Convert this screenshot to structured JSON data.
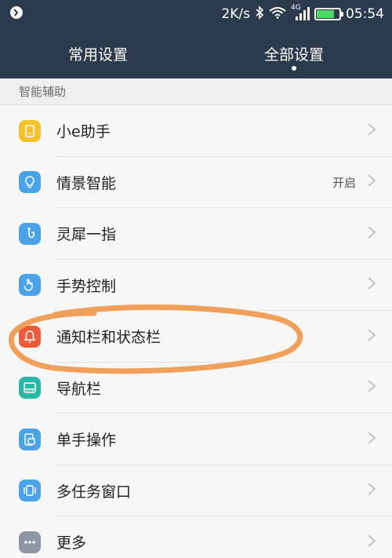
{
  "status_bar": {
    "speed": "2K/s",
    "network_label": "4G",
    "time": "05:54",
    "battery_level": 0.8
  },
  "tabs": [
    {
      "label": "常用设置",
      "active": false
    },
    {
      "label": "全部设置",
      "active": true
    }
  ],
  "section": {
    "title": "智能辅助"
  },
  "items": [
    {
      "label": "小e助手",
      "value": "",
      "icon": "phone-assistant-icon",
      "color": "#f6c12b"
    },
    {
      "label": "情景智能",
      "value": "开启",
      "icon": "lightbulb-icon",
      "color": "#4aa3e8"
    },
    {
      "label": "灵犀一指",
      "value": "",
      "icon": "finger-touch-icon",
      "color": "#4aa3e8"
    },
    {
      "label": "手势控制",
      "value": "",
      "icon": "hand-gesture-icon",
      "color": "#4aa3e8"
    },
    {
      "label": "通知栏和状态栏",
      "value": "",
      "icon": "bell-icon",
      "color": "#ee5a3c"
    },
    {
      "label": "导航栏",
      "value": "",
      "icon": "navigation-bar-icon",
      "color": "#28b8a5"
    },
    {
      "label": "单手操作",
      "value": "",
      "icon": "one-hand-icon",
      "color": "#4aa3e8"
    },
    {
      "label": "多任务窗口",
      "value": "",
      "icon": "multi-window-icon",
      "color": "#4aa3e8"
    },
    {
      "label": "更多",
      "value": "",
      "icon": "more-dots-icon",
      "color": "#8f96a3"
    }
  ],
  "annotation_color": "#f0a05a"
}
